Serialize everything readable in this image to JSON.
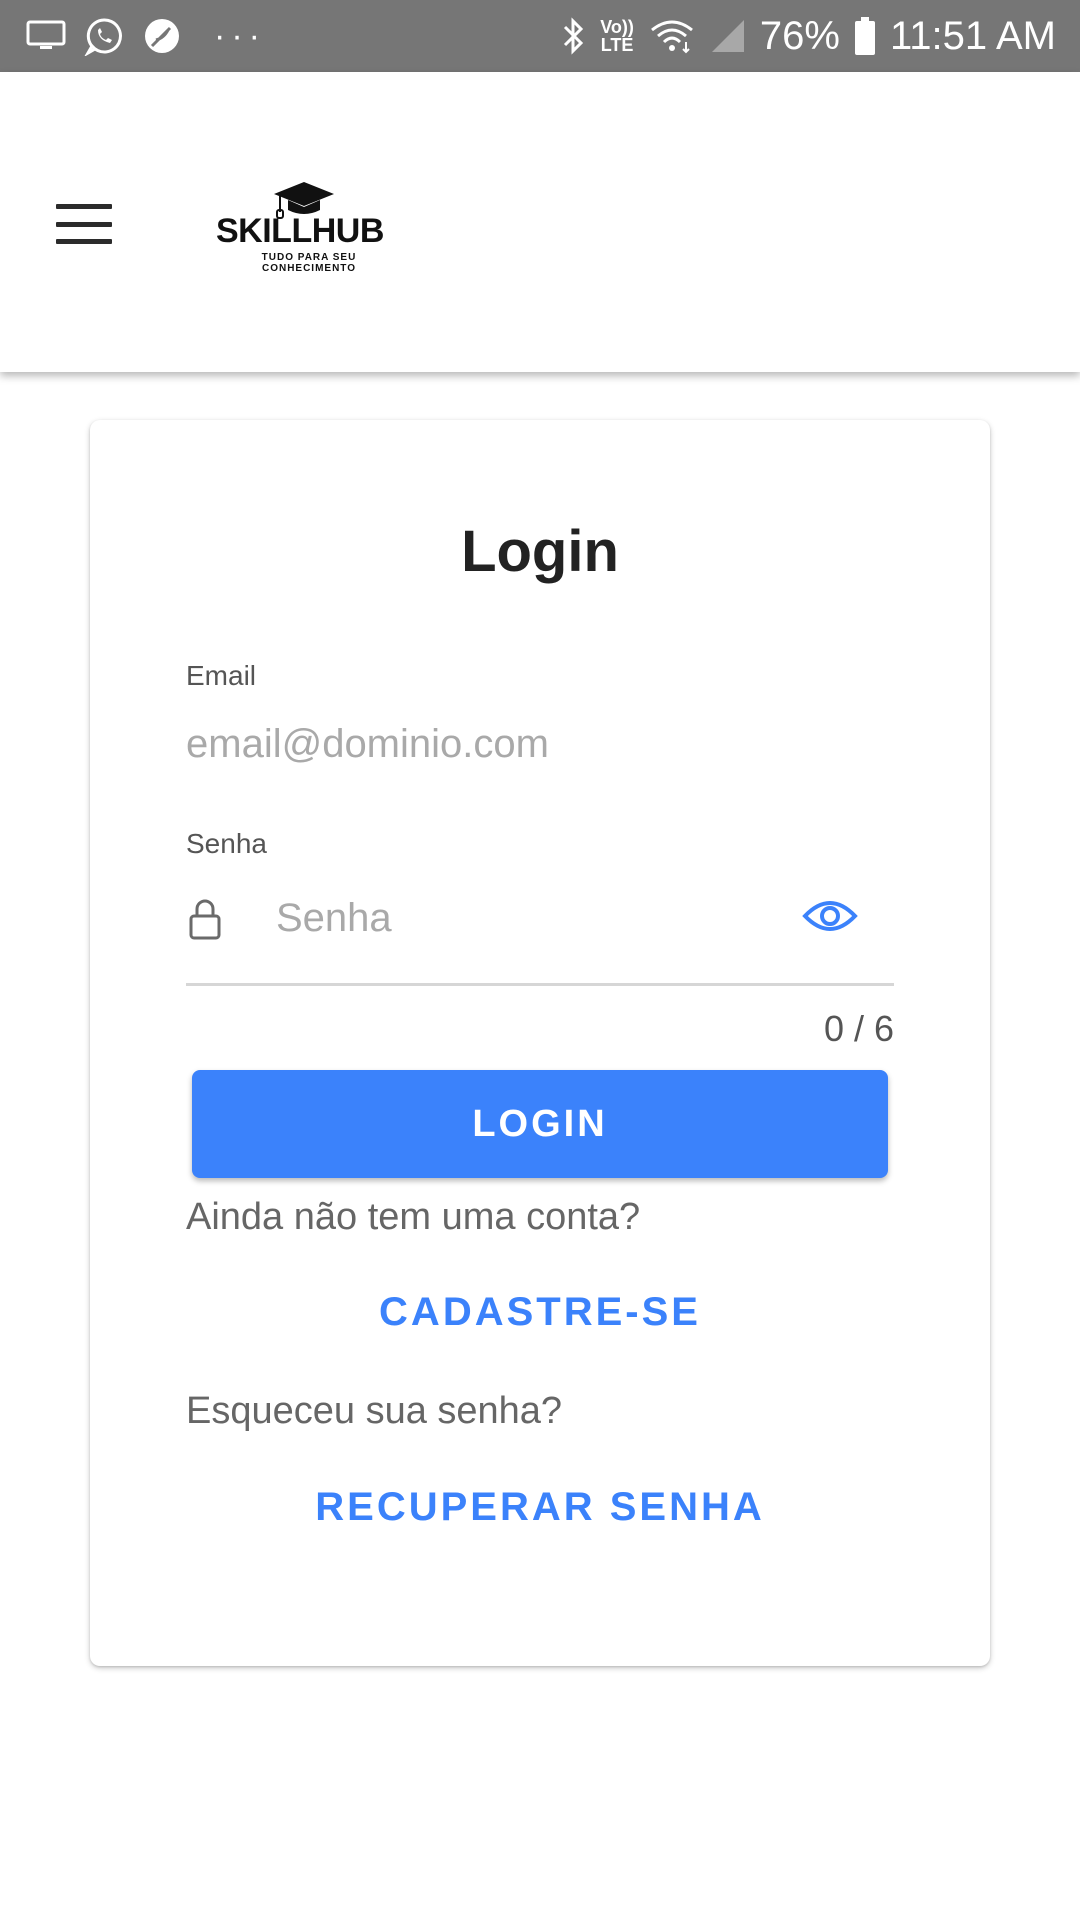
{
  "status_bar": {
    "battery": "76%",
    "time": "11:51 AM",
    "lte": "LTE",
    "volte": "Vo))",
    "more": "···",
    "icons": [
      "monitor-icon",
      "whatsapp-icon",
      "feather-icon",
      "bluetooth-icon",
      "volte-icon",
      "wifi-icon",
      "signal-icon",
      "battery-icon"
    ]
  },
  "app_bar": {
    "logo_name": "SKILLHUB",
    "logo_tagline": "TUDO PARA SEU CONHECIMENTO",
    "icons": [
      "menu-icon",
      "graduation-cap-icon"
    ]
  },
  "login_card": {
    "title": "Login",
    "email": {
      "label": "Email",
      "placeholder": "email@dominio.com",
      "value": ""
    },
    "password": {
      "label": "Senha",
      "placeholder": "Senha",
      "value": "",
      "counter": "0 / 6"
    },
    "login_button": "LOGIN",
    "signup_prompt": "Ainda não tem uma conta?",
    "signup_link": "CADASTRE-SE",
    "forgot_prompt": "Esqueceu sua senha?",
    "recover_link": "RECUPERAR SENHA",
    "icons": [
      "lock-icon",
      "eye-icon"
    ]
  },
  "colors": {
    "status_bar_bg": "#767676",
    "primary": "#3b82fb",
    "card_bg": "#ffffff",
    "text_dark": "#222222",
    "text_muted": "#666666",
    "placeholder": "#a9a9a9"
  }
}
